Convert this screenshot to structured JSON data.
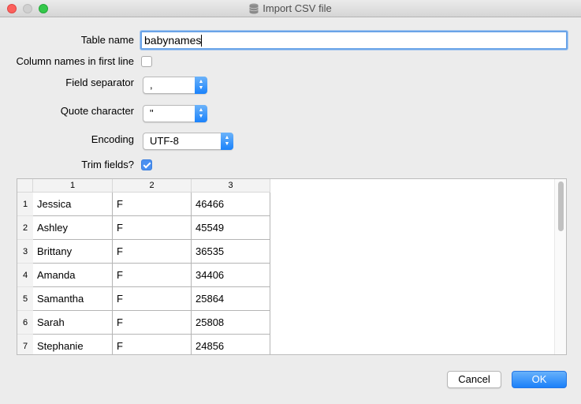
{
  "window": {
    "title": "Import CSV file"
  },
  "form": {
    "table_name_label": "Table name",
    "table_name_value": "babynames",
    "column_names_label": "Column names in first line",
    "column_names_checked": false,
    "field_separator_label": "Field separator",
    "field_separator_value": ",",
    "quote_char_label": "Quote character",
    "quote_char_value": "\"",
    "encoding_label": "Encoding",
    "encoding_value": "UTF-8",
    "trim_fields_label": "Trim fields?",
    "trim_fields_checked": true
  },
  "preview": {
    "headers": [
      "1",
      "2",
      "3"
    ],
    "row_numbers": [
      "1",
      "2",
      "3",
      "4",
      "5",
      "6",
      "7"
    ],
    "rows": [
      [
        "Jessica",
        "F",
        "46466"
      ],
      [
        "Ashley",
        "F",
        "45549"
      ],
      [
        "Brittany",
        "F",
        "36535"
      ],
      [
        "Amanda",
        "F",
        "34406"
      ],
      [
        "Samantha",
        "F",
        "25864"
      ],
      [
        "Sarah",
        "F",
        "25808"
      ],
      [
        "Stephanie",
        "F",
        "24856"
      ]
    ]
  },
  "buttons": {
    "cancel": "Cancel",
    "ok": "OK"
  },
  "colors": {
    "accent": "#4a90f1",
    "ok_button": "#1b80f9"
  }
}
